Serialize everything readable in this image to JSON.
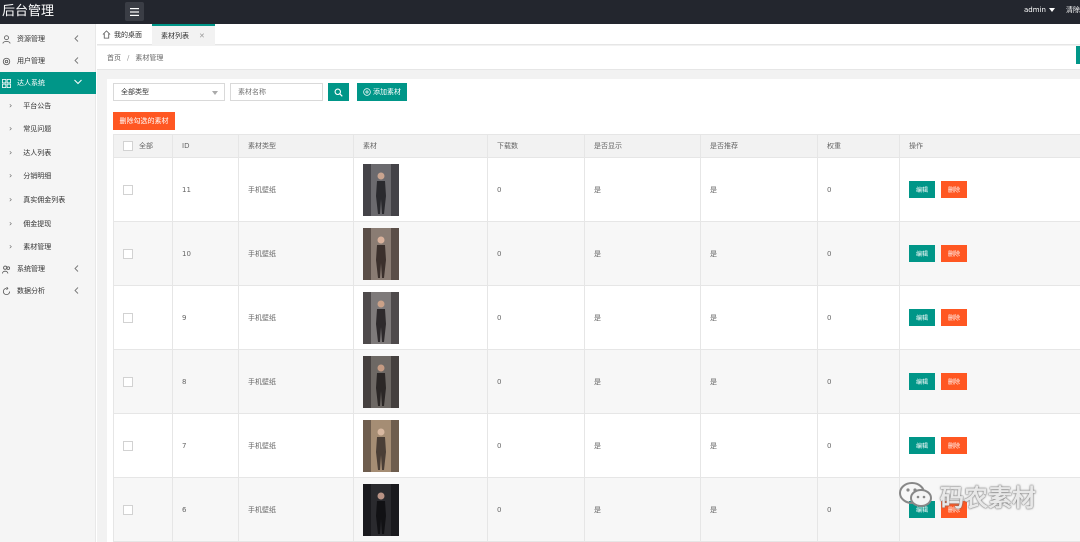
{
  "app": {
    "title": "后台管理",
    "user": "admin",
    "extra": "清除"
  },
  "sidebar": {
    "items": [
      {
        "label": "资源管理",
        "icon": "user-icon"
      },
      {
        "label": "用户管理",
        "icon": "gear-icon"
      },
      {
        "label": "达人系统",
        "icon": "grid-icon",
        "expanded": true,
        "active": true
      },
      {
        "label": "系统管理",
        "icon": "people-icon"
      },
      {
        "label": "数据分析",
        "icon": "circle-icon"
      }
    ],
    "sub_items": [
      "平台公告",
      "常见问题",
      "达人列表",
      "分销明细",
      "真实佣金列表",
      "佣金提现",
      "素材管理"
    ]
  },
  "tabs": [
    {
      "label": "我的桌面",
      "icon": "home-icon"
    },
    {
      "label": "素材列表",
      "closable": true,
      "active": true
    }
  ],
  "breadcrumb": {
    "home": "首页",
    "separator": "/",
    "current": "素材管理"
  },
  "toolbar": {
    "type_select": "全部类型",
    "search_placeholder": "素材名称",
    "add_label": "添加素材",
    "delete_selected_label": "删除勾选的素材"
  },
  "table": {
    "headers": [
      "全部",
      "ID",
      "素材类型",
      "素材",
      "下载数",
      "是否显示",
      "是否推荐",
      "权重",
      "操作"
    ],
    "edit_label": "编辑",
    "delete_label": "删除",
    "rows": [
      {
        "id": "11",
        "type": "手机壁纸",
        "downloads": "0",
        "show": "是",
        "recommend": "是",
        "weight": "0"
      },
      {
        "id": "10",
        "type": "手机壁纸",
        "downloads": "0",
        "show": "是",
        "recommend": "是",
        "weight": "0"
      },
      {
        "id": "9",
        "type": "手机壁纸",
        "downloads": "0",
        "show": "是",
        "recommend": "是",
        "weight": "0"
      },
      {
        "id": "8",
        "type": "手机壁纸",
        "downloads": "0",
        "show": "是",
        "recommend": "是",
        "weight": "0"
      },
      {
        "id": "7",
        "type": "手机壁纸",
        "downloads": "0",
        "show": "是",
        "recommend": "是",
        "weight": "0"
      },
      {
        "id": "6",
        "type": "手机壁纸",
        "downloads": "0",
        "show": "是",
        "recommend": "是",
        "weight": "0"
      }
    ]
  },
  "watermark": "码农素材",
  "colors": {
    "topbar": "#23262e",
    "accent": "#009688",
    "danger": "#ff5722",
    "background": "#f2f2f2"
  }
}
